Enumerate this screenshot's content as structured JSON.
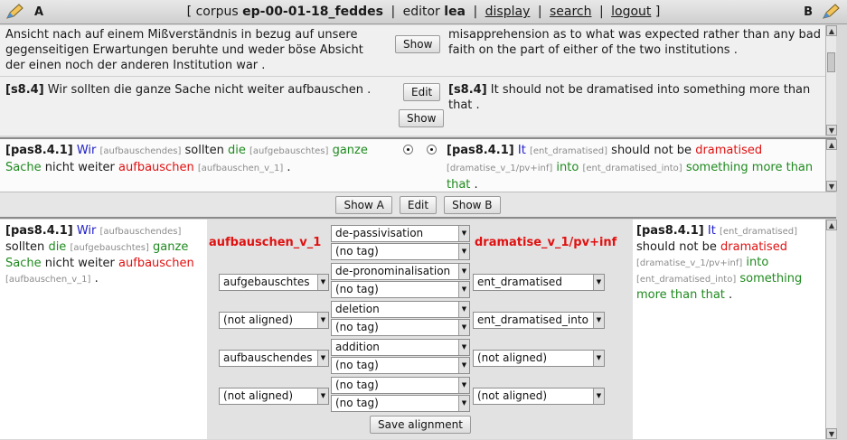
{
  "topbar": {
    "left_label": "A",
    "right_label": "B",
    "open_bracket": "[",
    "corpus_label": "corpus",
    "corpus_value": "ep-00-01-18_feddes",
    "sep1": "|",
    "editor_label": "editor",
    "editor_value": "lea",
    "sep2": "|",
    "display": "display",
    "sep3": "|",
    "search": "search",
    "sep4": "|",
    "logout": "logout",
    "close_bracket": "]"
  },
  "sentences": {
    "prev_de": "Ansicht nach auf einem Mißverständnis in bezug auf unsere gegenseitigen Erwartungen beruhte und weder böse Absicht der einen noch der anderen Institution war .",
    "prev_en": "misapprehension as to what was expected rather than any bad faith on the part of either of the two institutions .",
    "show_btn": "Show",
    "cur_id_de": "[s8.4]",
    "cur_de": "Wir sollten die ganze Sache nicht weiter aufbauschen .",
    "cur_id_en": "[s8.4]",
    "cur_en": "It should not be dramatised into something more than that .",
    "edit_btn": "Edit",
    "show_btn2": "Show"
  },
  "phrase": {
    "id_de": "[pas8.4.1]",
    "de": [
      {
        "t": "Wir",
        "c": "blue"
      },
      {
        "t": "[aufbauschendes]",
        "c": "tag"
      },
      {
        "t": "sollten",
        "c": ""
      },
      {
        "t": "die",
        "c": "green"
      },
      {
        "t": "[aufgebauschtes]",
        "c": "tag"
      },
      {
        "t": "ganze",
        "c": "green"
      },
      {
        "t": "Sache",
        "c": "green"
      },
      {
        "t": "nicht weiter",
        "c": ""
      },
      {
        "t": "aufbauschen",
        "c": "red"
      },
      {
        "t": "[aufbauschen_v_1]",
        "c": "tag"
      },
      {
        "t": ".",
        "c": ""
      }
    ],
    "id_en": "[pas8.4.1]",
    "en": [
      {
        "t": "It",
        "c": "blue"
      },
      {
        "t": "[ent_dramatised]",
        "c": "tag"
      },
      {
        "t": "should not be",
        "c": ""
      },
      {
        "t": "dramatised",
        "c": "red"
      },
      {
        "t": "[dramatise_v_1/pv+inf]",
        "c": "tag"
      },
      {
        "t": "into",
        "c": "green"
      },
      {
        "t": "[ent_dramatised_into]",
        "c": "tag"
      },
      {
        "t": "something more than that",
        "c": "green"
      },
      {
        "t": ".",
        "c": ""
      }
    ]
  },
  "controls": {
    "show_a": "Show A",
    "edit": "Edit",
    "show_b": "Show B"
  },
  "align": {
    "head_de": "aufbauschen_v_1",
    "head_en": "dramatise_v_1/pv+inf",
    "rows": [
      {
        "de": "",
        "rel": "de-passivisation",
        "tag": "(no tag)",
        "en": ""
      },
      {
        "de": "aufgebauschtes",
        "rel": "de-pronominalisation",
        "tag": "(no tag)",
        "en": "ent_dramatised"
      },
      {
        "de": "(not aligned)",
        "rel": "deletion",
        "tag": "(no tag)",
        "en": "ent_dramatised_into"
      },
      {
        "de": "aufbauschendes",
        "rel": "addition",
        "tag": "(no tag)",
        "en": "(not aligned)"
      },
      {
        "de": "(not aligned)",
        "rel": "(no tag)",
        "tag": "(no tag)",
        "en": "(not aligned)"
      }
    ],
    "save": "Save alignment"
  },
  "colors": {
    "red": "#e01010",
    "green": "#1f8a1f",
    "blue": "#2020c8",
    "tag": "#8c8c8c"
  }
}
